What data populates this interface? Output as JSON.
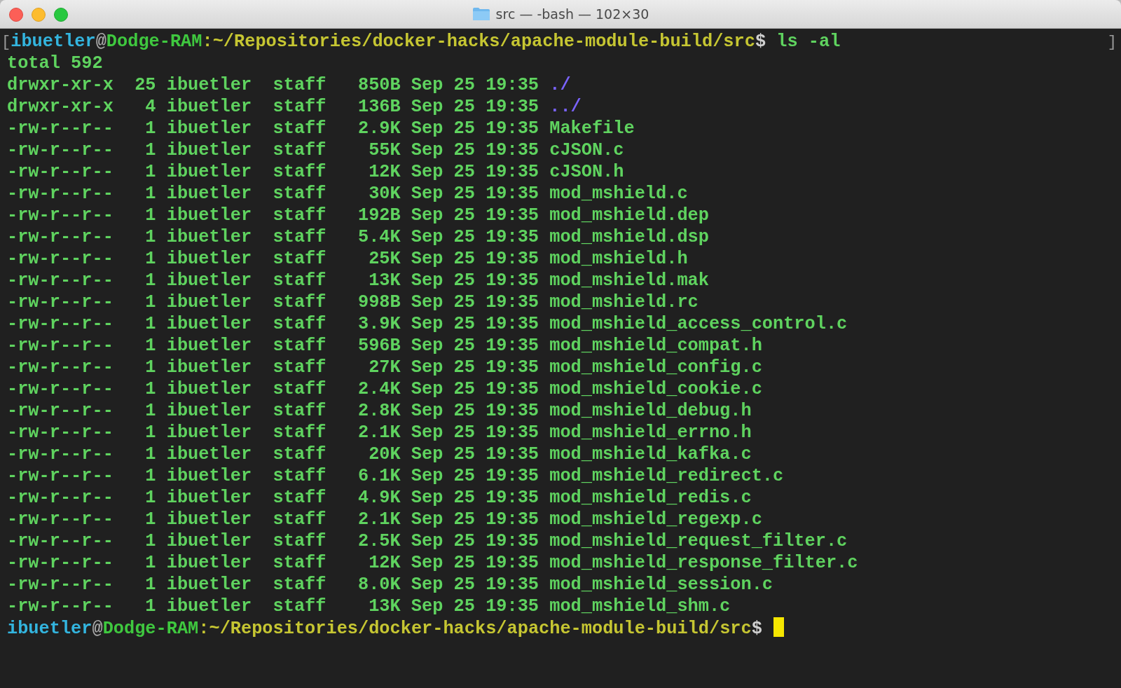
{
  "window": {
    "title": "src — -bash — 102×30"
  },
  "command_prompt": [
    {
      "kind": "bracket",
      "text": "["
    },
    {
      "kind": "user",
      "text": "ibuetler"
    },
    {
      "kind": "separator",
      "text": "@"
    },
    {
      "kind": "host",
      "text": "Dodge-RAM"
    },
    {
      "kind": "colon",
      "text": ":"
    },
    {
      "kind": "path",
      "text": "~/Repositories/docker-hacks/apache-module-build/src"
    },
    {
      "kind": "dollar",
      "text": "$"
    },
    {
      "kind": "command",
      "text": " ls -al"
    }
  ],
  "right_marker": "]",
  "total_line": "total 592",
  "listing": [
    {
      "info": "drwxr-xr-x  25 ibuetler  staff   850B Sep 25 19:35",
      "name": "./",
      "kind": "directory"
    },
    {
      "info": "drwxr-xr-x   4 ibuetler  staff   136B Sep 25 19:35",
      "name": "../",
      "kind": "directory"
    },
    {
      "info": "-rw-r--r--   1 ibuetler  staff   2.9K Sep 25 19:35",
      "name": "Makefile",
      "kind": "file"
    },
    {
      "info": "-rw-r--r--   1 ibuetler  staff    55K Sep 25 19:35",
      "name": "cJSON.c",
      "kind": "file"
    },
    {
      "info": "-rw-r--r--   1 ibuetler  staff    12K Sep 25 19:35",
      "name": "cJSON.h",
      "kind": "file"
    },
    {
      "info": "-rw-r--r--   1 ibuetler  staff    30K Sep 25 19:35",
      "name": "mod_mshield.c",
      "kind": "file"
    },
    {
      "info": "-rw-r--r--   1 ibuetler  staff   192B Sep 25 19:35",
      "name": "mod_mshield.dep",
      "kind": "file"
    },
    {
      "info": "-rw-r--r--   1 ibuetler  staff   5.4K Sep 25 19:35",
      "name": "mod_mshield.dsp",
      "kind": "file"
    },
    {
      "info": "-rw-r--r--   1 ibuetler  staff    25K Sep 25 19:35",
      "name": "mod_mshield.h",
      "kind": "file"
    },
    {
      "info": "-rw-r--r--   1 ibuetler  staff    13K Sep 25 19:35",
      "name": "mod_mshield.mak",
      "kind": "file"
    },
    {
      "info": "-rw-r--r--   1 ibuetler  staff   998B Sep 25 19:35",
      "name": "mod_mshield.rc",
      "kind": "file"
    },
    {
      "info": "-rw-r--r--   1 ibuetler  staff   3.9K Sep 25 19:35",
      "name": "mod_mshield_access_control.c",
      "kind": "file"
    },
    {
      "info": "-rw-r--r--   1 ibuetler  staff   596B Sep 25 19:35",
      "name": "mod_mshield_compat.h",
      "kind": "file"
    },
    {
      "info": "-rw-r--r--   1 ibuetler  staff    27K Sep 25 19:35",
      "name": "mod_mshield_config.c",
      "kind": "file"
    },
    {
      "info": "-rw-r--r--   1 ibuetler  staff   2.4K Sep 25 19:35",
      "name": "mod_mshield_cookie.c",
      "kind": "file"
    },
    {
      "info": "-rw-r--r--   1 ibuetler  staff   2.8K Sep 25 19:35",
      "name": "mod_mshield_debug.h",
      "kind": "file"
    },
    {
      "info": "-rw-r--r--   1 ibuetler  staff   2.1K Sep 25 19:35",
      "name": "mod_mshield_errno.h",
      "kind": "file"
    },
    {
      "info": "-rw-r--r--   1 ibuetler  staff    20K Sep 25 19:35",
      "name": "mod_mshield_kafka.c",
      "kind": "file"
    },
    {
      "info": "-rw-r--r--   1 ibuetler  staff   6.1K Sep 25 19:35",
      "name": "mod_mshield_redirect.c",
      "kind": "file"
    },
    {
      "info": "-rw-r--r--   1 ibuetler  staff   4.9K Sep 25 19:35",
      "name": "mod_mshield_redis.c",
      "kind": "file"
    },
    {
      "info": "-rw-r--r--   1 ibuetler  staff   2.1K Sep 25 19:35",
      "name": "mod_mshield_regexp.c",
      "kind": "file"
    },
    {
      "info": "-rw-r--r--   1 ibuetler  staff   2.5K Sep 25 19:35",
      "name": "mod_mshield_request_filter.c",
      "kind": "file"
    },
    {
      "info": "-rw-r--r--   1 ibuetler  staff    12K Sep 25 19:35",
      "name": "mod_mshield_response_filter.c",
      "kind": "file"
    },
    {
      "info": "-rw-r--r--   1 ibuetler  staff   8.0K Sep 25 19:35",
      "name": "mod_mshield_session.c",
      "kind": "file"
    },
    {
      "info": "-rw-r--r--   1 ibuetler  staff    13K Sep 25 19:35",
      "name": "mod_mshield_shm.c",
      "kind": "file"
    }
  ],
  "final_prompt": [
    {
      "kind": "user",
      "text": "ibuetler"
    },
    {
      "kind": "separator",
      "text": "@"
    },
    {
      "kind": "host",
      "text": "Dodge-RAM"
    },
    {
      "kind": "colon",
      "text": ":"
    },
    {
      "kind": "path",
      "text": "~/Repositories/docker-hacks/apache-module-build/src"
    },
    {
      "kind": "dollar",
      "text": "$"
    }
  ]
}
